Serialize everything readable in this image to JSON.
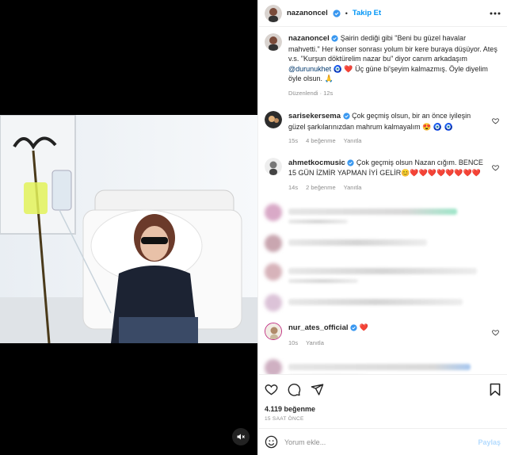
{
  "post": {
    "author": "nazanoncel",
    "follow_label": "Takip Et",
    "dot": "•",
    "caption_author": "nazanoncel",
    "caption_text_1": " Şairin dediği gibi \"Beni bu güzel havalar mahvetti.\" Her konser sonrası yolum bir kere buraya düşüyor. Ateş v.s. \"Kurşun döktürelim nazar bu\" diyor canım arkadaşım ",
    "caption_mention": "@durunukhet",
    "caption_text_2": " 🧿 ❤️ Üç güne bi'şeyim kalmazmış. Öyle diyelim öyle olsun. 🙏",
    "caption_meta": "Düzenlendi · 12s"
  },
  "comments": [
    {
      "user": "sarisekersema",
      "text": " Çok geçmiş olsun, bir an önce iyileşin güzel şarkılarınızdan mahrum kalmayalım 😍 🧿 🧿",
      "time": "15s",
      "likes": "4 beğenme",
      "reply": "Yanıtla"
    },
    {
      "user": "ahmetkocmusic",
      "text": " Çok geçmiş olsun Nazan cığım. BENCE 15 GÜN İZMİR YAPMAN İYİ GELİR😊❤️❤️❤️❤️❤️❤️❤️❤️",
      "time": "14s",
      "likes": "2 beğenme",
      "reply": "Yanıtla"
    },
    {
      "user": "nur_ates_official",
      "text": " ❤️",
      "time": "10s",
      "reply": "Yanıtla"
    }
  ],
  "footer": {
    "likes": "4.119 beğenme",
    "time": "15 SAAT ÖNCE",
    "comment_placeholder": "Yorum ekle...",
    "post_label": "Paylaş"
  },
  "colors": {
    "accent": "#0095f6",
    "heart": "#ed4956",
    "verified": "#3897f0"
  }
}
